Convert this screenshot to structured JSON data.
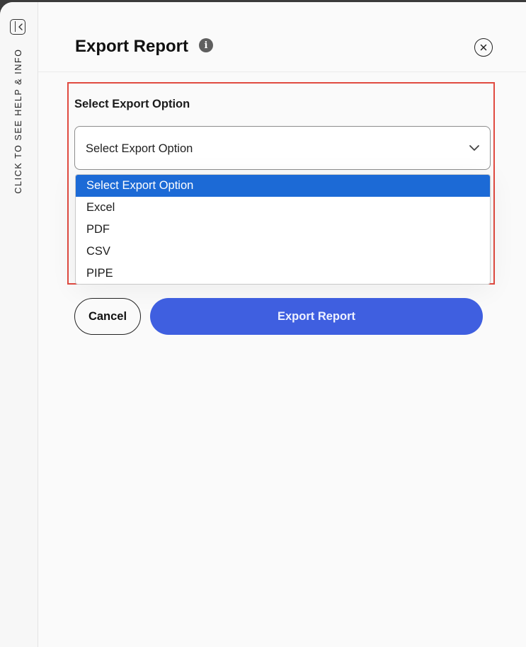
{
  "help_rail": {
    "label": "CLICK TO SEE HELP & INFO"
  },
  "header": {
    "title": "Export Report"
  },
  "form": {
    "field_label": "Select Export Option",
    "select_value": "Select Export Option",
    "options": [
      {
        "label": "Select Export Option",
        "selected": true
      },
      {
        "label": "Excel",
        "selected": false
      },
      {
        "label": "PDF",
        "selected": false
      },
      {
        "label": "CSV",
        "selected": false
      },
      {
        "label": "PIPE",
        "selected": false
      }
    ]
  },
  "actions": {
    "cancel_label": "Cancel",
    "export_label": "Export Report"
  },
  "colors": {
    "primary": "#3f5fe0",
    "option_highlight": "#1c6ad6",
    "annotation_border": "#e04a40"
  },
  "icons": {
    "info": "info-icon",
    "close": "close-icon",
    "chevron": "chevron-down-icon",
    "rail_toggle": "panel-collapse-icon"
  }
}
